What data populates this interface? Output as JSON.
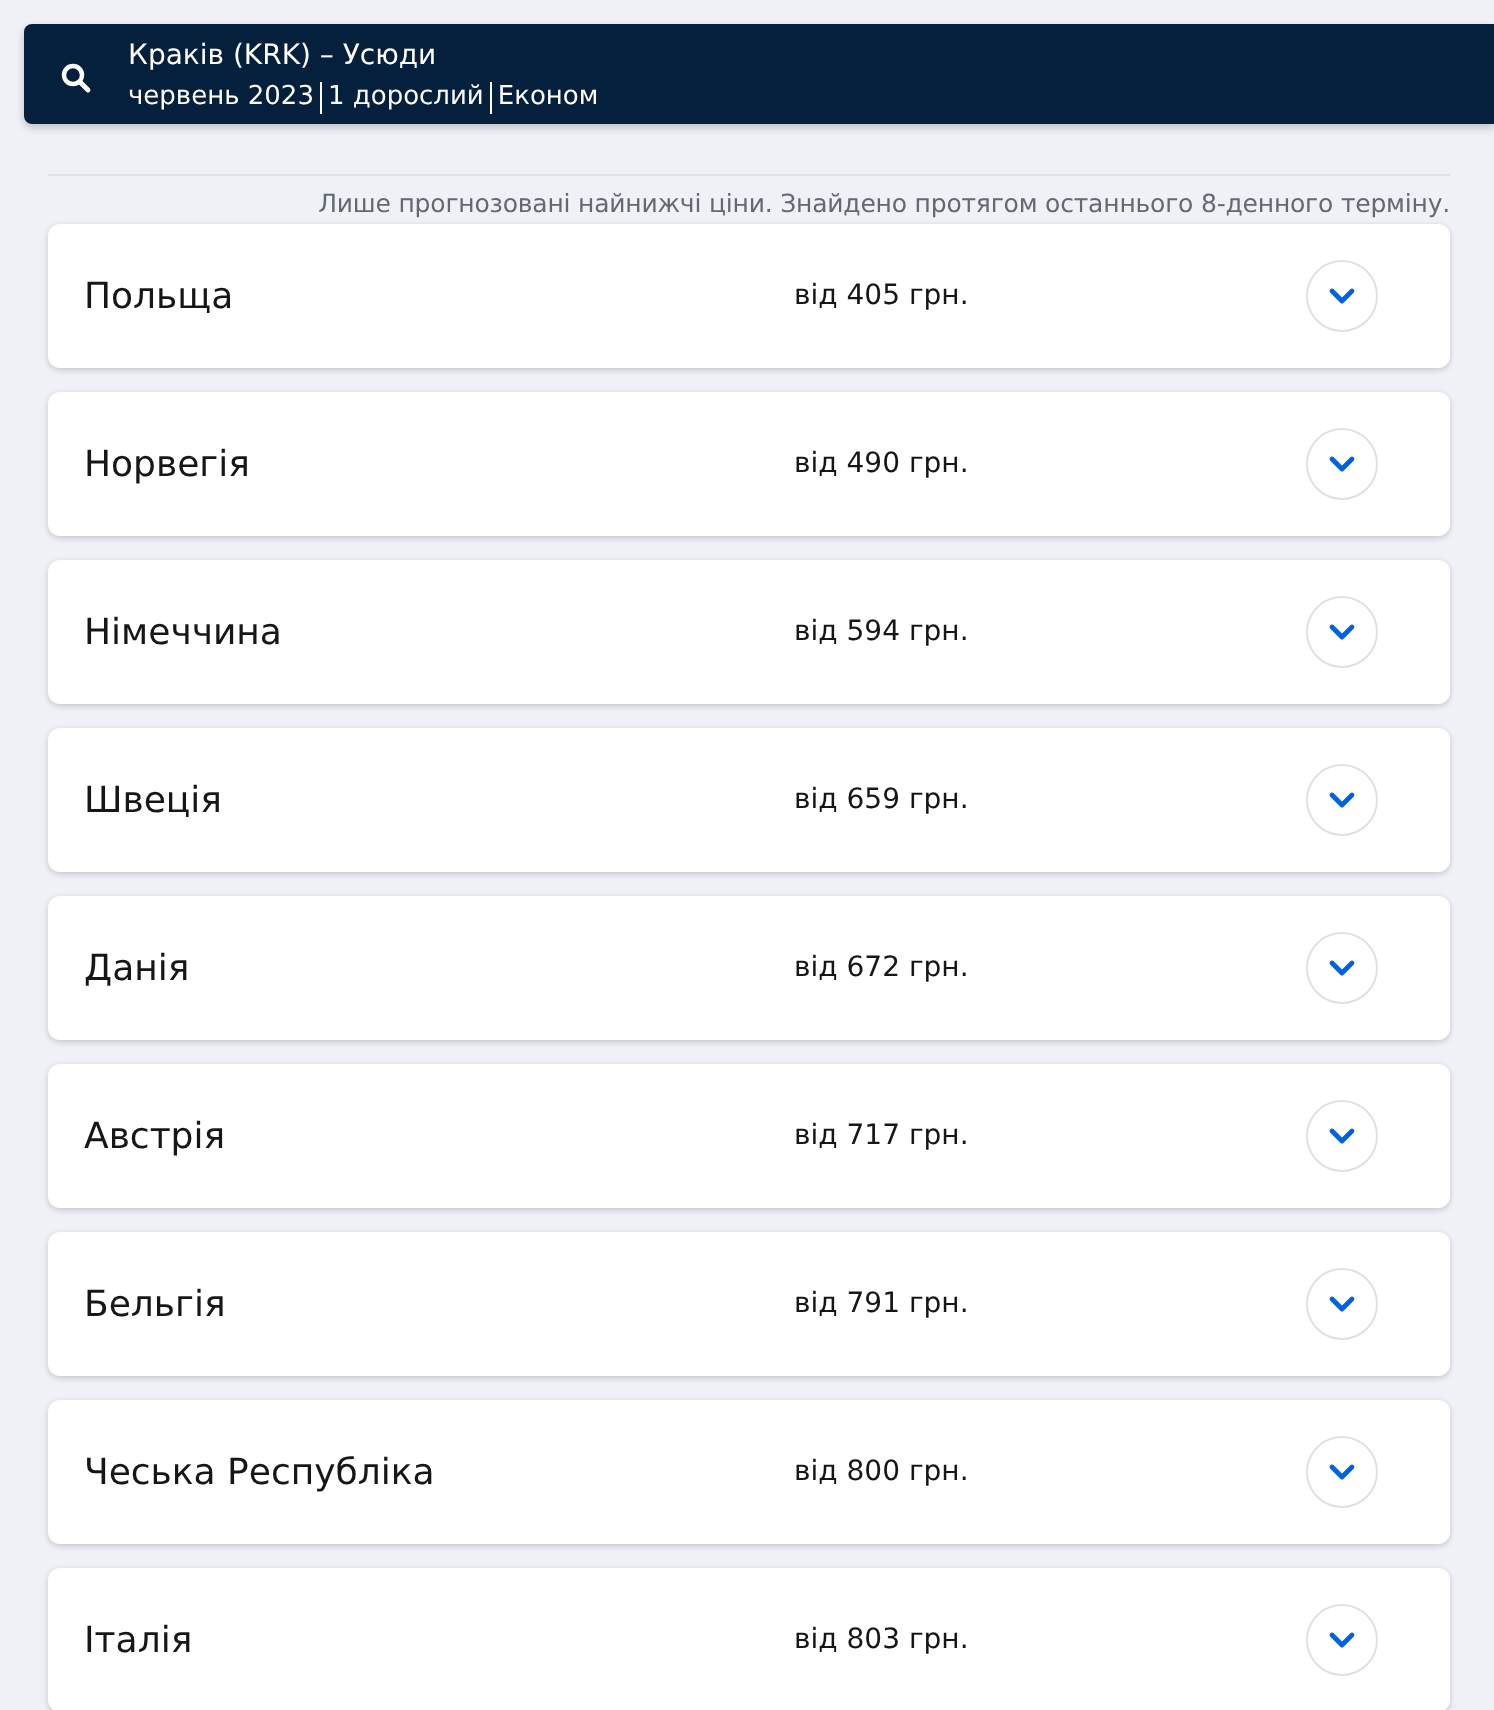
{
  "search": {
    "route": "Краків (KRK) – Усюди",
    "details": [
      "червень 2023",
      "1 дорослий",
      "Економ"
    ]
  },
  "note": "Лише прогнозовані найнижчі ціни. Знайдено протягом останнього 8-денного терміну.",
  "destinations": [
    {
      "country": "Польща",
      "price": "від 405 грн.",
      "expanded": false
    },
    {
      "country": "Норвегія",
      "price": "від 490 грн.",
      "expanded": false
    },
    {
      "country": "Німеччина",
      "price": "від 594 грн.",
      "expanded": false
    },
    {
      "country": "Швеція",
      "price": "від 659 грн.",
      "expanded": false
    },
    {
      "country": "Данія",
      "price": "від 672 грн.",
      "expanded": false
    },
    {
      "country": "Австрія",
      "price": "від 717 грн.",
      "expanded": false
    },
    {
      "country": "Бельгія",
      "price": "від 791 грн.",
      "expanded": false
    },
    {
      "country": "Чеська Республіка",
      "price": "від 800 грн.",
      "expanded": false
    },
    {
      "country": "Італія",
      "price": "від 803 грн.",
      "expanded": false
    }
  ]
}
